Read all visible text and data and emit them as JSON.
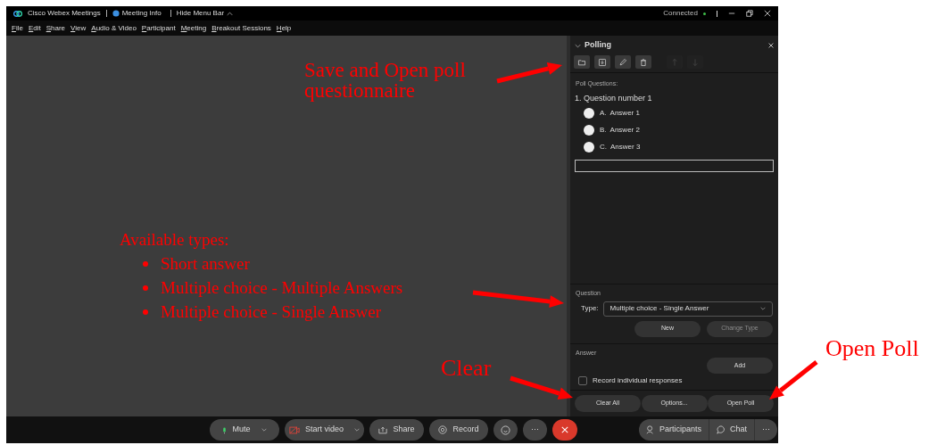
{
  "title_bar": {
    "app": "Cisco Webex Meetings",
    "meeting_info": "Meeting Info",
    "hide_menu_bar": "Hide Menu Bar",
    "status": "Connected"
  },
  "menu": [
    "File",
    "Edit",
    "Share",
    "View",
    "Audio & Video",
    "Participant",
    "Meeting",
    "Breakout Sessions",
    "Help"
  ],
  "polling": {
    "title": "Polling",
    "toolbar": [
      {
        "kind": "folder",
        "disabled": false
      },
      {
        "kind": "save",
        "disabled": false
      },
      {
        "kind": "pencil",
        "disabled": false
      },
      {
        "kind": "trash",
        "disabled": false
      },
      {
        "kind": "up",
        "disabled": true
      },
      {
        "kind": "down",
        "disabled": true
      }
    ],
    "questions_label": "Poll Questions:",
    "question": {
      "number": "1.",
      "text": "Question number 1"
    },
    "answers": [
      {
        "letter": "A.",
        "text": "Answer 1",
        "selected": false
      },
      {
        "letter": "B.",
        "text": "Answer 2",
        "selected": false
      },
      {
        "letter": "C.",
        "text": "Answer 3",
        "selected": false
      }
    ],
    "question_section": {
      "label": "Question",
      "type_label": "Type:",
      "type_value": "Multiple choice - Single Answer",
      "buttons": [
        {
          "label": "New",
          "disabled": false
        },
        {
          "label": "Change Type",
          "disabled": true
        }
      ]
    },
    "answer_section": {
      "label": "Answer",
      "add": "Add",
      "record": {
        "label": "Record individual responses",
        "checked": false
      }
    },
    "footer_buttons": [
      "Clear All",
      "Options...",
      "Open Poll"
    ]
  },
  "controls": [
    {
      "kind": "mute",
      "label": "Mute",
      "menu": true
    },
    {
      "kind": "video",
      "label": "Start video",
      "menu": true
    },
    {
      "kind": "share",
      "label": "Share",
      "menu": false
    },
    {
      "kind": "record",
      "label": "Record",
      "menu": false
    },
    {
      "kind": "emoji",
      "menu": false
    },
    {
      "kind": "more",
      "label": "···",
      "menu": false
    },
    {
      "kind": "end",
      "menu": false
    }
  ],
  "side_controls": [
    {
      "kind": "participants",
      "label": "Participants"
    },
    {
      "kind": "chat",
      "label": "Chat"
    },
    {
      "kind": "more",
      "label": "···"
    }
  ],
  "annotations": {
    "save_open": [
      "Save and Open poll",
      "questionnaire"
    ],
    "types_heading": "Available types:",
    "types": [
      "Short answer",
      "Multiple choice - Multiple Answers",
      "Multiple choice - Single Answer"
    ],
    "clear": "Clear",
    "open_poll": "Open Poll"
  }
}
